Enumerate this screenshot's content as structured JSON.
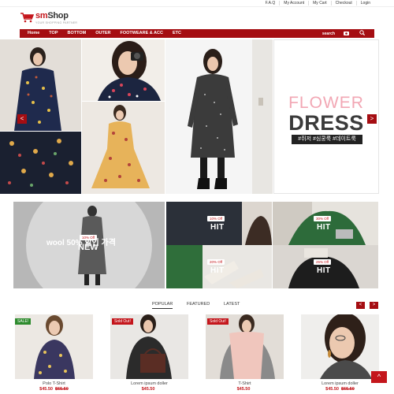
{
  "toplinks": [
    "F.A.Q",
    "My Account",
    "My Cart",
    "Checkout",
    "Login"
  ],
  "logo": {
    "name_a": "sm",
    "name_b": "Shop",
    "tagline": "YOUR SHOPPING PARTNER"
  },
  "nav": {
    "items": [
      "Home",
      "TOP",
      "BOTTOM",
      "OUTER",
      "FOOTWEARE & ACC",
      "ETC"
    ],
    "search_label": "search",
    "icons": [
      "camera-icon",
      "search-icon"
    ]
  },
  "banner": {
    "line1": "FLOWER",
    "line2": "DRESS",
    "tags": "#쥐저 #심쿵룩 #데이트룩",
    "prev": "<",
    "next": ">"
  },
  "promo": {
    "big_text": "wool 50% 할인 가격",
    "big_badge": "10% Off",
    "big_word": "NEW",
    "tiles": [
      {
        "badge": "10% Off",
        "label": "HIT"
      },
      {
        "badge": "30% Off",
        "label": "HIT"
      },
      {
        "badge": "20% Off",
        "label": "HIT"
      },
      {
        "badge": "25% Off",
        "label": "HIT"
      }
    ]
  },
  "tabs": [
    "POPULAR",
    "FEATURED",
    "LATEST"
  ],
  "pager": {
    "prev": "<",
    "next": ">"
  },
  "products": [
    {
      "tag": "SALE!",
      "name": "Polo T-Shirt",
      "price": "$45.50",
      "old": "$65.50"
    },
    {
      "tag": "Sold Out!",
      "name": "Lorem ipsum doller",
      "price": "$45.50",
      "old": ""
    },
    {
      "tag": "Sold Out!",
      "name": "T-Shirt",
      "price": "$45.50",
      "old": ""
    },
    {
      "tag": "",
      "name": "Lorem ipsum doller",
      "price": "$45.50",
      "old": "$65.50"
    }
  ],
  "totop": "^",
  "colors": {
    "brand": "#a50d12",
    "accent": "#c4161c",
    "sale": "#2e8b2e"
  }
}
